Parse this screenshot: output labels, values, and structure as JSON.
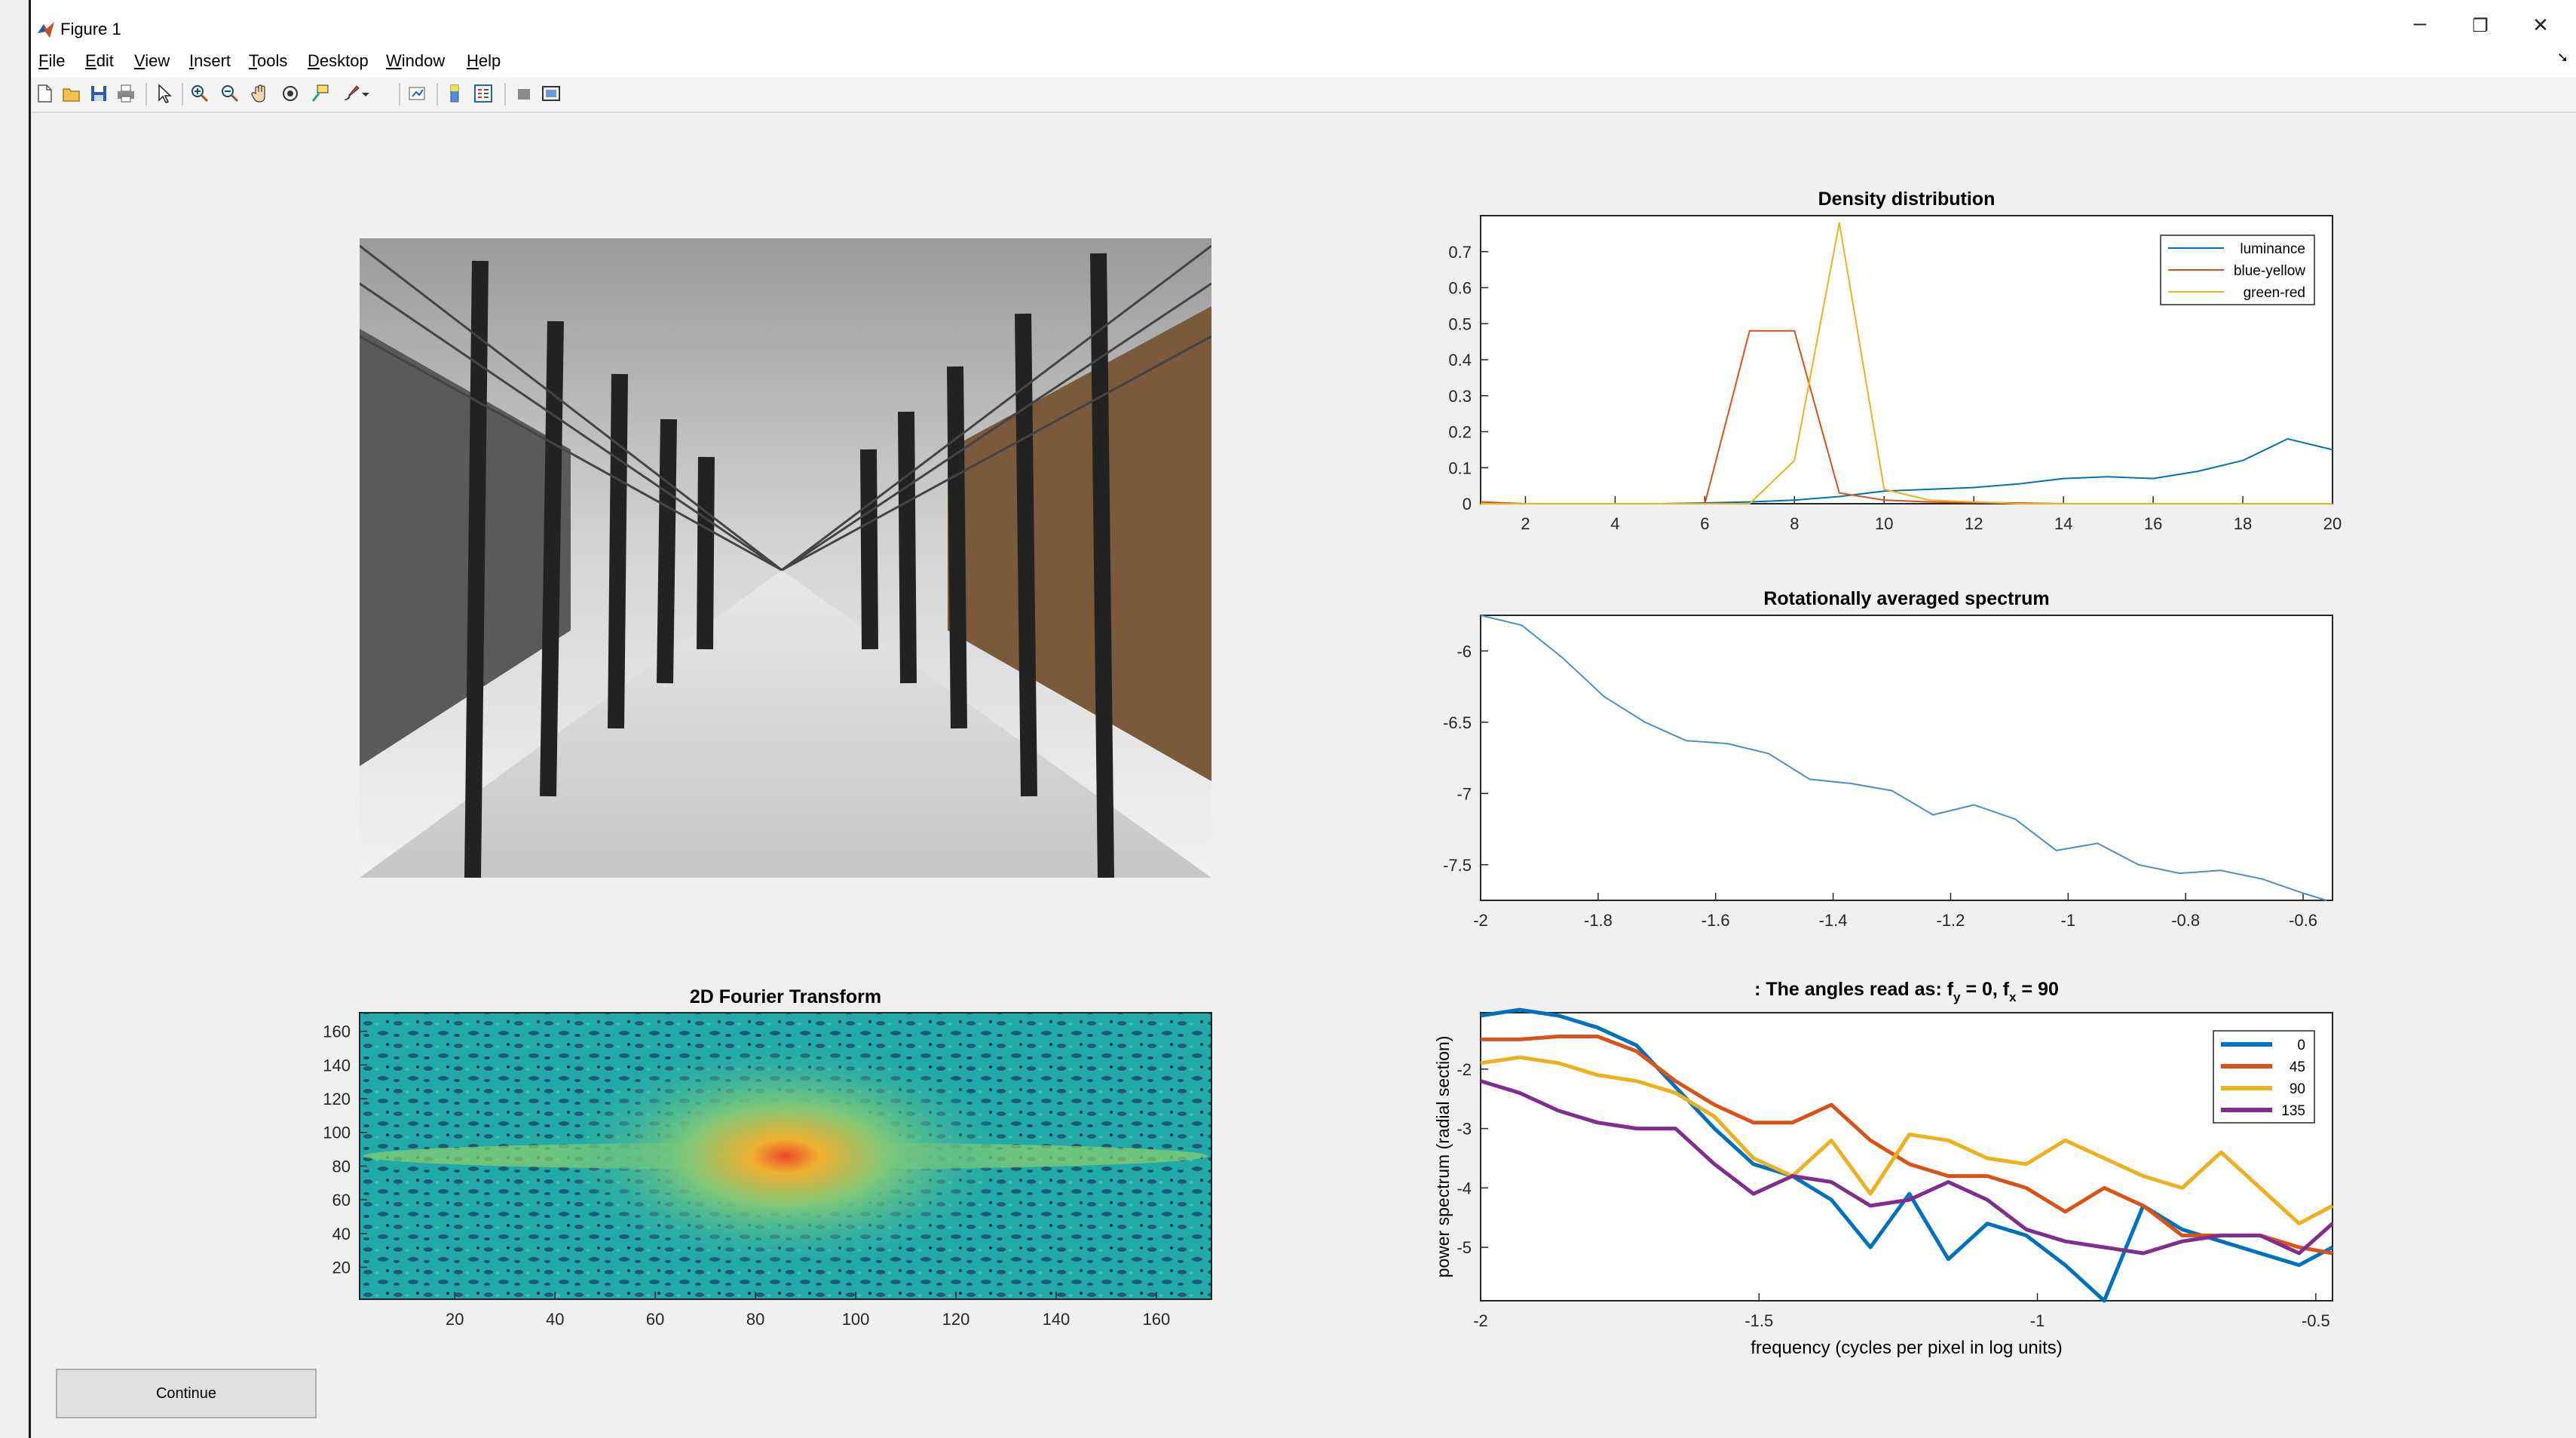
{
  "window": {
    "title": "Figure 1",
    "minimize": "–",
    "restore": "❐",
    "close": "✕"
  },
  "menu": [
    {
      "pre": "",
      "ul": "F",
      "post": "ile"
    },
    {
      "pre": "",
      "ul": "E",
      "post": "dit"
    },
    {
      "pre": "",
      "ul": "V",
      "post": "iew"
    },
    {
      "pre": "",
      "ul": "I",
      "post": "nsert"
    },
    {
      "pre": "",
      "ul": "T",
      "post": "ools"
    },
    {
      "pre": "",
      "ul": "D",
      "post": "esktop"
    },
    {
      "pre": "",
      "ul": "W",
      "post": "indow"
    },
    {
      "pre": "",
      "ul": "H",
      "post": "elp"
    }
  ],
  "toolbar_icons": [
    "new-figure-icon",
    "open-file-icon",
    "save-icon",
    "print-icon",
    "pointer-icon",
    "zoom-in-icon",
    "zoom-out-icon",
    "pan-icon",
    "rotate-icon",
    "data-cursor-icon",
    "brush-icon",
    "link-plot-icon",
    "colorbar-icon",
    "legend-icon",
    "hide-plot-tools-icon",
    "show-plot-tools-icon"
  ],
  "image": {
    "description_name": "snowy-fence-corridor-image"
  },
  "continue_label": "Continue",
  "chart_data": [
    {
      "type": "line",
      "title": "Density distribution",
      "xlim": [
        1,
        20
      ],
      "ylim": [
        0,
        0.8
      ],
      "xticks": [
        2,
        4,
        6,
        8,
        10,
        12,
        14,
        16,
        18,
        20
      ],
      "yticks": [
        0,
        0.1,
        0.2,
        0.3,
        0.4,
        0.5,
        0.6,
        0.7
      ],
      "legend": "top-right",
      "series": [
        {
          "name": "luminance",
          "color": "#0072BD",
          "x": [
            1,
            2,
            3,
            4,
            5,
            6,
            7,
            8,
            9,
            10,
            11,
            12,
            13,
            14,
            15,
            16,
            17,
            18,
            19,
            20
          ],
          "y": [
            0,
            0,
            0,
            0,
            0,
            0.002,
            0.005,
            0.01,
            0.02,
            0.035,
            0.04,
            0.045,
            0.055,
            0.07,
            0.075,
            0.07,
            0.09,
            0.12,
            0.18,
            0.15
          ]
        },
        {
          "name": "blue-yellow",
          "color": "#D95319",
          "x": [
            1,
            2,
            3,
            4,
            5,
            6,
            7,
            8,
            9,
            10,
            11,
            12,
            13,
            14,
            15,
            16,
            17,
            18,
            19,
            20
          ],
          "y": [
            0.005,
            0,
            0,
            0,
            0,
            0,
            0.48,
            0.48,
            0.03,
            0.01,
            0.005,
            0.003,
            0.002,
            0,
            0,
            0,
            0,
            0,
            0,
            0
          ]
        },
        {
          "name": "green-red",
          "color": "#EDB120",
          "x": [
            1,
            2,
            3,
            4,
            5,
            6,
            7,
            8,
            9,
            10,
            11,
            12,
            13,
            14,
            15,
            16,
            17,
            18,
            19,
            20
          ],
          "y": [
            0,
            0,
            0,
            0,
            0,
            0,
            0,
            0.12,
            0.78,
            0.04,
            0.01,
            0.005,
            0,
            0,
            0,
            0,
            0,
            0,
            0,
            0
          ]
        }
      ]
    },
    {
      "type": "line",
      "title": "Rotationally averaged spectrum",
      "xlim": [
        -2,
        -0.55
      ],
      "ylim": [
        -7.75,
        -5.75
      ],
      "xticks": [
        -2,
        -1.8,
        -1.6,
        -1.4,
        -1.2,
        -1,
        -0.8,
        -0.6
      ],
      "yticks": [
        -7.5,
        -7,
        -6.5,
        -6
      ],
      "series": [
        {
          "color": "#4a90c8",
          "x": [
            -2,
            -1.93,
            -1.86,
            -1.79,
            -1.72,
            -1.65,
            -1.58,
            -1.51,
            -1.44,
            -1.37,
            -1.3,
            -1.23,
            -1.16,
            -1.09,
            -1.02,
            -0.95,
            -0.88,
            -0.81,
            -0.74,
            -0.67,
            -0.6,
            -0.56
          ],
          "y": [
            -5.75,
            -5.82,
            -6.05,
            -6.32,
            -6.5,
            -6.63,
            -6.65,
            -6.72,
            -6.9,
            -6.93,
            -6.98,
            -7.15,
            -7.08,
            -7.18,
            -7.4,
            -7.35,
            -7.5,
            -7.56,
            -7.54,
            -7.6,
            -7.7,
            -7.75
          ]
        }
      ]
    },
    {
      "type": "heatmap",
      "title": "2D Fourier Transform",
      "xlim": [
        1,
        171
      ],
      "ylim": [
        1,
        171
      ],
      "xticks": [
        20,
        40,
        60,
        80,
        100,
        120,
        140,
        160
      ],
      "yticks": [
        20,
        40,
        60,
        80,
        100,
        120,
        140,
        160
      ]
    },
    {
      "type": "line",
      "title_parts": [
        ": The angles read as: f",
        "y",
        " = 0, f",
        "x",
        " = 90"
      ],
      "xlabel": "frequency (cycles per pixel in log units)",
      "ylabel": "power spectrum (radial section)",
      "xlim": [
        -2,
        -0.47
      ],
      "ylim": [
        -5.9,
        -1.05
      ],
      "xticks": [
        -2,
        -1.5,
        -1,
        -0.5
      ],
      "yticks": [
        -5,
        -4,
        -3,
        -2
      ],
      "legend": "top-right",
      "series": [
        {
          "name": "0",
          "color": "#0072BD",
          "x": [
            -2,
            -1.93,
            -1.86,
            -1.79,
            -1.72,
            -1.65,
            -1.58,
            -1.51,
            -1.44,
            -1.37,
            -1.3,
            -1.23,
            -1.16,
            -1.09,
            -1.02,
            -0.95,
            -0.88,
            -0.81,
            -0.74,
            -0.67,
            -0.6,
            -0.53,
            -0.47
          ],
          "y": [
            -1.1,
            -1.0,
            -1.1,
            -1.3,
            -1.6,
            -2.3,
            -3.0,
            -3.6,
            -3.8,
            -4.2,
            -5.0,
            -4.1,
            -5.2,
            -4.6,
            -4.8,
            -5.3,
            -5.9,
            -4.3,
            -4.7,
            -4.9,
            -5.1,
            -5.3,
            -5.0
          ]
        },
        {
          "name": "45",
          "color": "#D95319",
          "x": [
            -2,
            -1.93,
            -1.86,
            -1.79,
            -1.72,
            -1.65,
            -1.58,
            -1.51,
            -1.44,
            -1.37,
            -1.3,
            -1.23,
            -1.16,
            -1.09,
            -1.02,
            -0.95,
            -0.88,
            -0.81,
            -0.74,
            -0.67,
            -0.6,
            -0.53,
            -0.47
          ],
          "y": [
            -1.5,
            -1.5,
            -1.45,
            -1.45,
            -1.7,
            -2.2,
            -2.6,
            -2.9,
            -2.9,
            -2.6,
            -3.2,
            -3.6,
            -3.8,
            -3.8,
            -4.0,
            -4.4,
            -4.0,
            -4.3,
            -4.8,
            -4.8,
            -4.8,
            -5.0,
            -5.1
          ]
        },
        {
          "name": "90",
          "color": "#EDB120",
          "x": [
            -2,
            -1.93,
            -1.86,
            -1.79,
            -1.72,
            -1.65,
            -1.58,
            -1.51,
            -1.44,
            -1.37,
            -1.3,
            -1.23,
            -1.16,
            -1.09,
            -1.02,
            -0.95,
            -0.88,
            -0.81,
            -0.74,
            -0.67,
            -0.6,
            -0.53,
            -0.47
          ],
          "y": [
            -1.9,
            -1.8,
            -1.9,
            -2.1,
            -2.2,
            -2.4,
            -2.8,
            -3.5,
            -3.8,
            -3.2,
            -4.1,
            -3.1,
            -3.2,
            -3.5,
            -3.6,
            -3.2,
            -3.5,
            -3.8,
            -4.0,
            -3.4,
            -4.0,
            -4.6,
            -4.3
          ]
        },
        {
          "name": "135",
          "color": "#7E2F8E",
          "x": [
            -2,
            -1.93,
            -1.86,
            -1.79,
            -1.72,
            -1.65,
            -1.58,
            -1.51,
            -1.44,
            -1.37,
            -1.3,
            -1.23,
            -1.16,
            -1.09,
            -1.02,
            -0.95,
            -0.88,
            -0.81,
            -0.74,
            -0.67,
            -0.6,
            -0.53,
            -0.47
          ],
          "y": [
            -2.2,
            -2.4,
            -2.7,
            -2.9,
            -3.0,
            -3.0,
            -3.6,
            -4.1,
            -3.8,
            -3.9,
            -4.3,
            -4.2,
            -3.9,
            -4.2,
            -4.7,
            -4.9,
            -5.0,
            -5.1,
            -4.9,
            -4.8,
            -4.8,
            -5.1,
            -4.6
          ]
        }
      ]
    }
  ]
}
